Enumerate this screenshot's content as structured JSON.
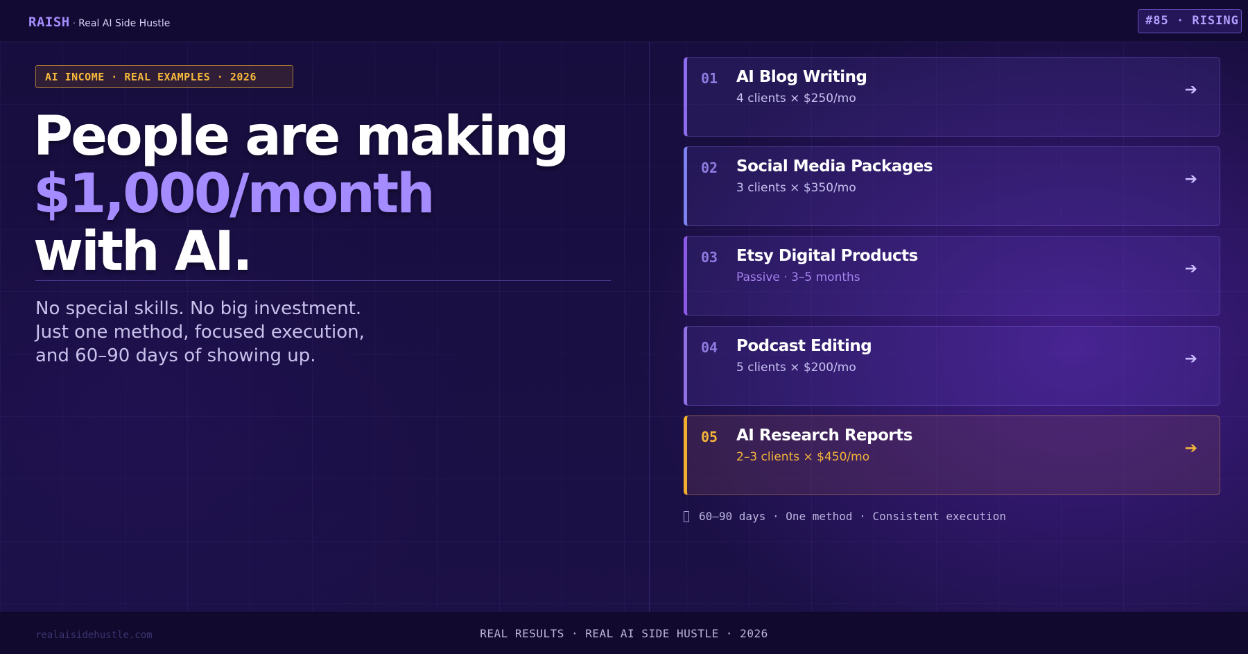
{
  "header": {
    "logo": "RAISH",
    "separator": "·",
    "tagline": "Real AI Side Hustle",
    "rank_badge": "#85 · RISING"
  },
  "hero": {
    "pill": "AI INCOME  ·  REAL EXAMPLES  ·  2026",
    "headline_line1": "People are making",
    "headline_line2": "$1,000/month",
    "headline_line3": "with AI.",
    "subcopy_line1": "No special skills. No big investment.",
    "subcopy_line2": "Just one method, focused execution,",
    "subcopy_line3": "and 60–90 days of showing up."
  },
  "methods": [
    {
      "num": "01",
      "title": "AI Blog Writing",
      "meta": "4 clients × $250/mo",
      "arrow": "➔"
    },
    {
      "num": "02",
      "title": "Social Media Packages",
      "meta": "3 clients × $350/mo",
      "arrow": "➔"
    },
    {
      "num": "03",
      "title": "Etsy Digital Products",
      "meta": "Passive · 3–5 months",
      "arrow": "➔"
    },
    {
      "num": "04",
      "title": "Podcast Editing",
      "meta": "5 clients × $200/mo",
      "arrow": "➔"
    },
    {
      "num": "05",
      "title": "AI Research Reports",
      "meta": "2–3 clients × $450/mo",
      "arrow": "➔"
    }
  ],
  "timeline": {
    "text": "60–90 days · One method · Consistent execution",
    "icon": "hourglass-icon"
  },
  "footer": {
    "url": "realaisidehustle.com",
    "tagline": "REAL RESULTS  ·  REAL AI SIDE HUSTLE  ·  2026"
  },
  "colors": {
    "accent": "#a48bff",
    "gold": "#f5b43a",
    "background": "#150d38"
  }
}
